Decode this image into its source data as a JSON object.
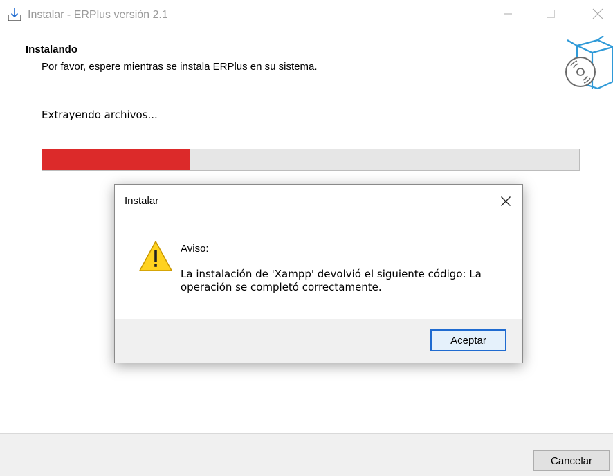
{
  "window": {
    "title": "Instalar - ERPlus versión 2.1",
    "icon": "install-download-icon"
  },
  "header": {
    "title": "Instalando",
    "subtitle": "Por favor, espere mientras se instala ERPlus en su sistema.",
    "icon": "software-box-icon"
  },
  "body": {
    "status": "Extrayendo archivos...",
    "progress": {
      "fraction": 0.275,
      "color": "#dc2a2a"
    }
  },
  "footer": {
    "cancel_label": "Cancelar"
  },
  "dialog": {
    "title": "Instalar",
    "icon": "warning-icon",
    "label": "Aviso:",
    "message": "La instalación de 'Xampp' devolvió el siguiente código: La operación se completó correctamente.",
    "accept_label": "Aceptar"
  },
  "colors": {
    "accent_blue": "#1f6bd0",
    "warning_yellow": "#ffd21f"
  }
}
